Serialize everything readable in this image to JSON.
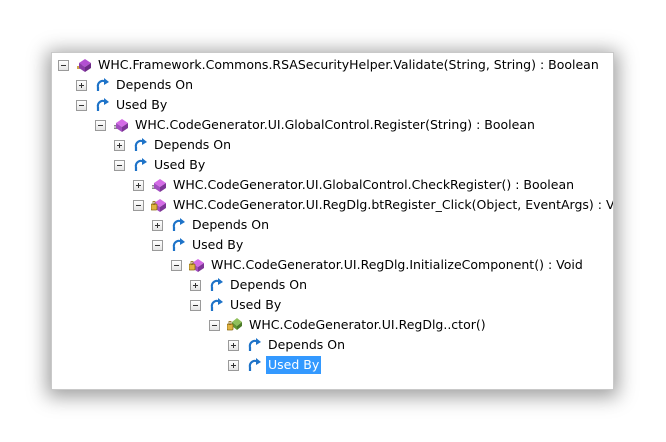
{
  "window": {
    "title": ""
  },
  "colors": {
    "selection": "#3399ff",
    "depends_icon": "#1e73c8",
    "method_icon": "#a04bbf"
  },
  "tree": {
    "root": {
      "label": "WHC.Framework.Commons.RSASecurityHelper.Validate(String, String) : Boolean",
      "icon": "method-icon"
    },
    "n1_depends": {
      "label": "Depends On",
      "icon": "depends-icon"
    },
    "n1_usedby": {
      "label": "Used By",
      "icon": "depends-icon"
    },
    "n2_method": {
      "label": "WHC.CodeGenerator.UI.GlobalControl.Register(String) : Boolean",
      "icon": "method-icon"
    },
    "n2_depends": {
      "label": "Depends On",
      "icon": "depends-icon"
    },
    "n2_usedby": {
      "label": "Used By",
      "icon": "depends-icon"
    },
    "n3_check": {
      "label": "WHC.CodeGenerator.UI.GlobalControl.CheckRegister() : Boolean",
      "icon": "method-icon"
    },
    "n3_click": {
      "label": "WHC.CodeGenerator.UI.RegDlg.btRegister_Click(Object, EventArgs) : Void",
      "icon": "private-method-icon"
    },
    "n4_depends": {
      "label": "Depends On",
      "icon": "depends-icon"
    },
    "n4_usedby": {
      "label": "Used By",
      "icon": "depends-icon"
    },
    "n5_init": {
      "label": "WHC.CodeGenerator.UI.RegDlg.InitializeComponent() : Void",
      "icon": "private-method-icon"
    },
    "n5_depends": {
      "label": "Depends On",
      "icon": "depends-icon"
    },
    "n5_usedby": {
      "label": "Used By",
      "icon": "depends-icon"
    },
    "n6_ctor": {
      "label": "WHC.CodeGenerator.UI.RegDlg..ctor()",
      "icon": "constructor-icon"
    },
    "n6_depends": {
      "label": "Depends On",
      "icon": "depends-icon"
    },
    "n6_usedby": {
      "label": "Used By",
      "icon": "depends-icon",
      "selected": true
    }
  }
}
